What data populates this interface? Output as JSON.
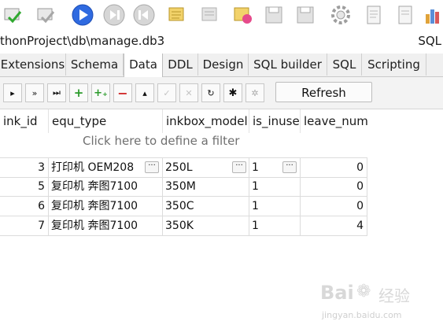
{
  "toolbar": {
    "icons": [
      "checkbox-icon",
      "checkbox-icon",
      "play-icon",
      "step-icon",
      "back-icon",
      "scroll-icon",
      "scroll-icon",
      "scroll-icon",
      "save-icon",
      "save-icon",
      "save-icon",
      "gear-icon",
      "document-icon",
      "document-icon",
      "chart-icon"
    ]
  },
  "path": {
    "text": "thonProject\\db\\manage.db3",
    "right": "SQL"
  },
  "tabs": [
    "Extensions",
    "Schema",
    "Data",
    "DDL",
    "Design",
    "SQL builder",
    "SQL",
    "Scripting"
  ],
  "active_tab": "Data",
  "buttons": {
    "refresh_label": "Refresh"
  },
  "grid": {
    "columns": [
      "ink_id",
      "equ_type",
      "inkbox_model",
      "is_inuse",
      "leave_num"
    ],
    "filter_hint": "Click here to define a filter",
    "rows": [
      {
        "ink_id": "3",
        "equ_type": "打印机 OEM208",
        "inkbox_model": "250L",
        "is_inuse": "1",
        "leave_num": "0"
      },
      {
        "ink_id": "5",
        "equ_type": "复印机 奔图7100",
        "inkbox_model": "350M",
        "is_inuse": "1",
        "leave_num": "0"
      },
      {
        "ink_id": "6",
        "equ_type": "复印机 奔图7100",
        "inkbox_model": "350C",
        "is_inuse": "1",
        "leave_num": "0"
      },
      {
        "ink_id": "7",
        "equ_type": "复印机 奔图7100",
        "inkbox_model": "350K",
        "is_inuse": "1",
        "leave_num": "4"
      }
    ],
    "ellipsis": "···"
  },
  "watermark": {
    "brand": "Bai",
    "brand2": "经验",
    "url": "jingyan.baidu.com"
  }
}
